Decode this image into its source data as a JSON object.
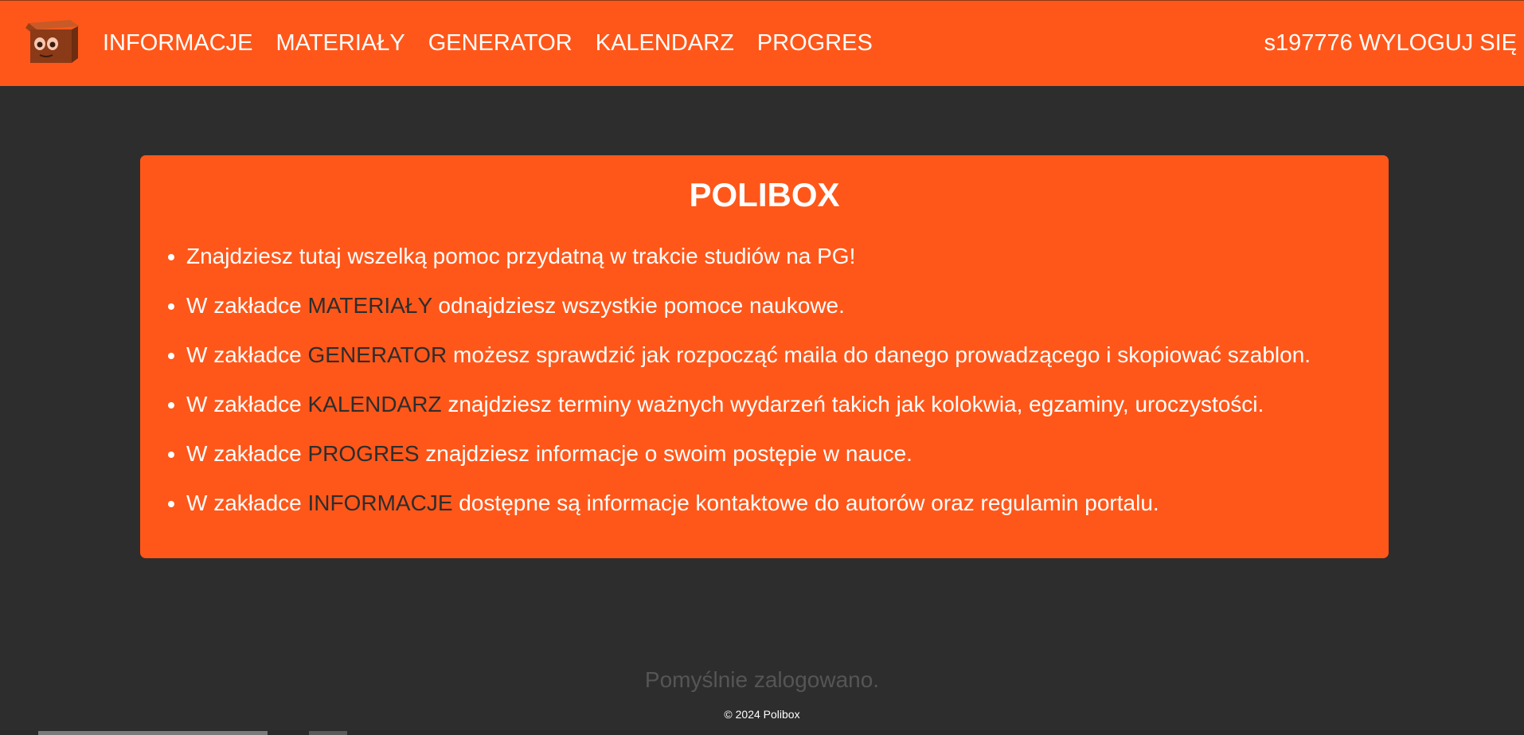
{
  "header": {
    "logo_icon": "polibox-box-mascot-icon",
    "nav": [
      {
        "label": "INFORMACJE"
      },
      {
        "label": "MATERIAŁY"
      },
      {
        "label": "GENERATOR"
      },
      {
        "label": "KALENDARZ"
      },
      {
        "label": "PROGRES"
      }
    ],
    "username": "s197776",
    "logout_label": "WYLOGUJ SIĘ"
  },
  "card": {
    "title": "POLIBOX",
    "items": [
      {
        "text": "Znajdziesz tutaj wszelką pomoc przydatną w trakcie studiów na PG!"
      },
      {
        "prefix": "W zakładce ",
        "keyword": "MATERIAŁY",
        "suffix": " odnajdziesz wszystkie pomoce naukowe."
      },
      {
        "prefix": "W zakładce ",
        "keyword": "GENERATOR",
        "suffix": " możesz sprawdzić jak rozpocząć maila do danego prowadzącego i skopiować szablon."
      },
      {
        "prefix": "W zakładce ",
        "keyword": "KALENDARZ",
        "suffix": " znajdziesz terminy ważnych wydarzeń takich jak kolokwia, egzaminy, uroczystości."
      },
      {
        "prefix": "W zakładce ",
        "keyword": "PROGRES",
        "suffix": " znajdziesz informacje o swoim postępie w nauce."
      },
      {
        "prefix": "W zakładce ",
        "keyword": "INFORMACJE",
        "suffix": " dostępne są informacje kontaktowe do autorów oraz regulamin portalu."
      }
    ]
  },
  "status_message": "Pomyślnie zalogowano.",
  "footer": {
    "copyright": "© 2024 Polibox"
  },
  "colors": {
    "accent": "#ff5719",
    "background": "#2d2d2d",
    "text_light": "#ffffff",
    "keyword": "#2d2d2d",
    "status_text": "#555555"
  }
}
